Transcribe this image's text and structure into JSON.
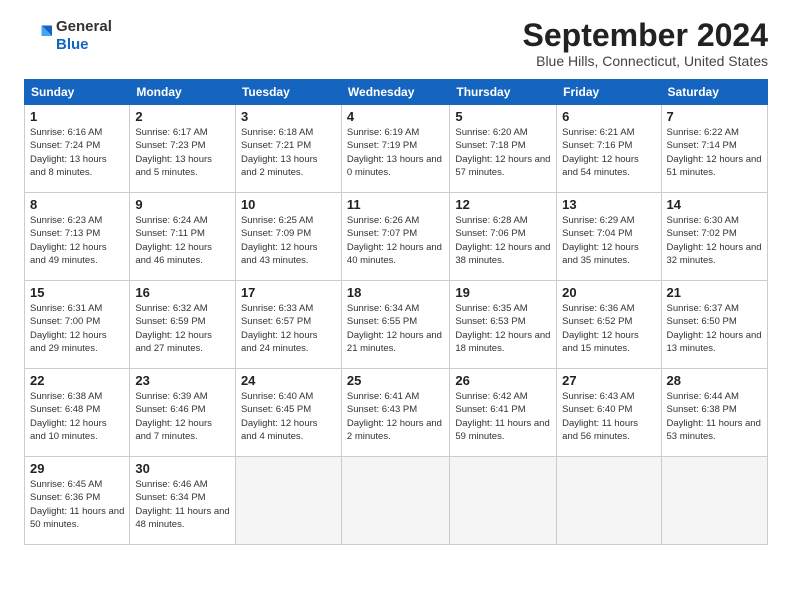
{
  "header": {
    "logo_general": "General",
    "logo_blue": "Blue",
    "month_title": "September 2024",
    "location": "Blue Hills, Connecticut, United States"
  },
  "days_of_week": [
    "Sunday",
    "Monday",
    "Tuesday",
    "Wednesday",
    "Thursday",
    "Friday",
    "Saturday"
  ],
  "weeks": [
    [
      {
        "day": "1",
        "sunrise": "Sunrise: 6:16 AM",
        "sunset": "Sunset: 7:24 PM",
        "daylight": "Daylight: 13 hours and 8 minutes."
      },
      {
        "day": "2",
        "sunrise": "Sunrise: 6:17 AM",
        "sunset": "Sunset: 7:23 PM",
        "daylight": "Daylight: 13 hours and 5 minutes."
      },
      {
        "day": "3",
        "sunrise": "Sunrise: 6:18 AM",
        "sunset": "Sunset: 7:21 PM",
        "daylight": "Daylight: 13 hours and 2 minutes."
      },
      {
        "day": "4",
        "sunrise": "Sunrise: 6:19 AM",
        "sunset": "Sunset: 7:19 PM",
        "daylight": "Daylight: 13 hours and 0 minutes."
      },
      {
        "day": "5",
        "sunrise": "Sunrise: 6:20 AM",
        "sunset": "Sunset: 7:18 PM",
        "daylight": "Daylight: 12 hours and 57 minutes."
      },
      {
        "day": "6",
        "sunrise": "Sunrise: 6:21 AM",
        "sunset": "Sunset: 7:16 PM",
        "daylight": "Daylight: 12 hours and 54 minutes."
      },
      {
        "day": "7",
        "sunrise": "Sunrise: 6:22 AM",
        "sunset": "Sunset: 7:14 PM",
        "daylight": "Daylight: 12 hours and 51 minutes."
      }
    ],
    [
      {
        "day": "8",
        "sunrise": "Sunrise: 6:23 AM",
        "sunset": "Sunset: 7:13 PM",
        "daylight": "Daylight: 12 hours and 49 minutes."
      },
      {
        "day": "9",
        "sunrise": "Sunrise: 6:24 AM",
        "sunset": "Sunset: 7:11 PM",
        "daylight": "Daylight: 12 hours and 46 minutes."
      },
      {
        "day": "10",
        "sunrise": "Sunrise: 6:25 AM",
        "sunset": "Sunset: 7:09 PM",
        "daylight": "Daylight: 12 hours and 43 minutes."
      },
      {
        "day": "11",
        "sunrise": "Sunrise: 6:26 AM",
        "sunset": "Sunset: 7:07 PM",
        "daylight": "Daylight: 12 hours and 40 minutes."
      },
      {
        "day": "12",
        "sunrise": "Sunrise: 6:28 AM",
        "sunset": "Sunset: 7:06 PM",
        "daylight": "Daylight: 12 hours and 38 minutes."
      },
      {
        "day": "13",
        "sunrise": "Sunrise: 6:29 AM",
        "sunset": "Sunset: 7:04 PM",
        "daylight": "Daylight: 12 hours and 35 minutes."
      },
      {
        "day": "14",
        "sunrise": "Sunrise: 6:30 AM",
        "sunset": "Sunset: 7:02 PM",
        "daylight": "Daylight: 12 hours and 32 minutes."
      }
    ],
    [
      {
        "day": "15",
        "sunrise": "Sunrise: 6:31 AM",
        "sunset": "Sunset: 7:00 PM",
        "daylight": "Daylight: 12 hours and 29 minutes."
      },
      {
        "day": "16",
        "sunrise": "Sunrise: 6:32 AM",
        "sunset": "Sunset: 6:59 PM",
        "daylight": "Daylight: 12 hours and 27 minutes."
      },
      {
        "day": "17",
        "sunrise": "Sunrise: 6:33 AM",
        "sunset": "Sunset: 6:57 PM",
        "daylight": "Daylight: 12 hours and 24 minutes."
      },
      {
        "day": "18",
        "sunrise": "Sunrise: 6:34 AM",
        "sunset": "Sunset: 6:55 PM",
        "daylight": "Daylight: 12 hours and 21 minutes."
      },
      {
        "day": "19",
        "sunrise": "Sunrise: 6:35 AM",
        "sunset": "Sunset: 6:53 PM",
        "daylight": "Daylight: 12 hours and 18 minutes."
      },
      {
        "day": "20",
        "sunrise": "Sunrise: 6:36 AM",
        "sunset": "Sunset: 6:52 PM",
        "daylight": "Daylight: 12 hours and 15 minutes."
      },
      {
        "day": "21",
        "sunrise": "Sunrise: 6:37 AM",
        "sunset": "Sunset: 6:50 PM",
        "daylight": "Daylight: 12 hours and 13 minutes."
      }
    ],
    [
      {
        "day": "22",
        "sunrise": "Sunrise: 6:38 AM",
        "sunset": "Sunset: 6:48 PM",
        "daylight": "Daylight: 12 hours and 10 minutes."
      },
      {
        "day": "23",
        "sunrise": "Sunrise: 6:39 AM",
        "sunset": "Sunset: 6:46 PM",
        "daylight": "Daylight: 12 hours and 7 minutes."
      },
      {
        "day": "24",
        "sunrise": "Sunrise: 6:40 AM",
        "sunset": "Sunset: 6:45 PM",
        "daylight": "Daylight: 12 hours and 4 minutes."
      },
      {
        "day": "25",
        "sunrise": "Sunrise: 6:41 AM",
        "sunset": "Sunset: 6:43 PM",
        "daylight": "Daylight: 12 hours and 2 minutes."
      },
      {
        "day": "26",
        "sunrise": "Sunrise: 6:42 AM",
        "sunset": "Sunset: 6:41 PM",
        "daylight": "Daylight: 11 hours and 59 minutes."
      },
      {
        "day": "27",
        "sunrise": "Sunrise: 6:43 AM",
        "sunset": "Sunset: 6:40 PM",
        "daylight": "Daylight: 11 hours and 56 minutes."
      },
      {
        "day": "28",
        "sunrise": "Sunrise: 6:44 AM",
        "sunset": "Sunset: 6:38 PM",
        "daylight": "Daylight: 11 hours and 53 minutes."
      }
    ],
    [
      {
        "day": "29",
        "sunrise": "Sunrise: 6:45 AM",
        "sunset": "Sunset: 6:36 PM",
        "daylight": "Daylight: 11 hours and 50 minutes."
      },
      {
        "day": "30",
        "sunrise": "Sunrise: 6:46 AM",
        "sunset": "Sunset: 6:34 PM",
        "daylight": "Daylight: 11 hours and 48 minutes."
      },
      null,
      null,
      null,
      null,
      null
    ]
  ]
}
